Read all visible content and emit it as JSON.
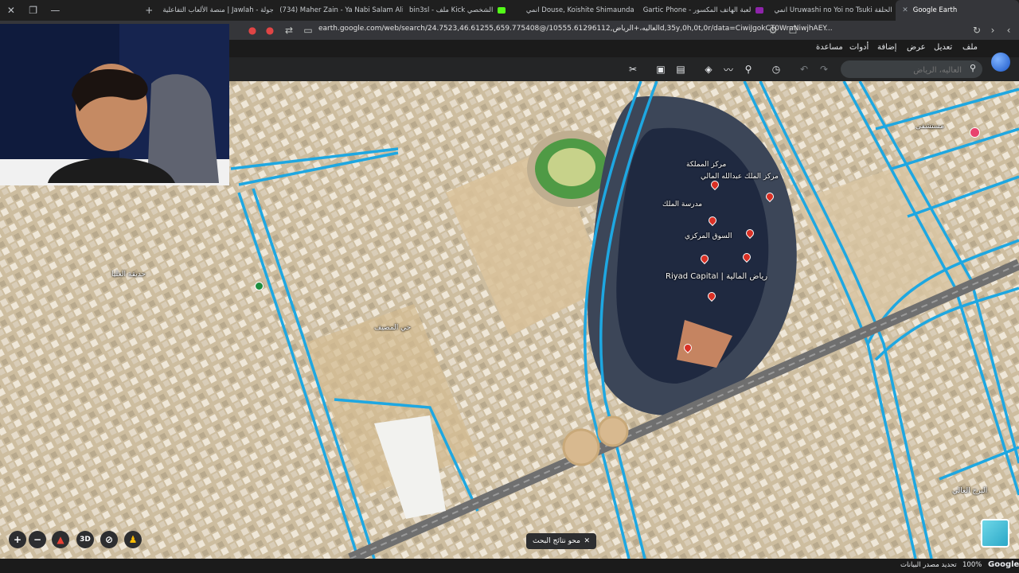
{
  "tabs": [
    {
      "label": "منصة الألعاب التفاعلية | Jawlah - جولة",
      "fav_color": "#f9ab00",
      "active": false
    },
    {
      "label": "(734) Maher Zain - Ya Nabi Salam Ali",
      "fav_color": "#ff0000",
      "active": false
    },
    {
      "label": "bin3sl - ملف Kick الشخصي",
      "fav_color": "#53fc18",
      "active": false
    },
    {
      "label": "انمي Douse, Koishite Shimaunda",
      "fav_color": "#c2185b",
      "active": false
    },
    {
      "label": "Gartic Phone - لعبة الهاتف المكسور",
      "fav_color": "#8e24aa",
      "active": false
    },
    {
      "label": "انمي Uruwashi no Yoi no Tsuki الحلقة",
      "fav_color": "#c2185b",
      "active": false
    },
    {
      "label": "Google Earth",
      "fav_color": "#4285f4",
      "active": true
    }
  ],
  "address": {
    "url": "earth.google.com/web/search/24.7523,46.61255,659.775408@/العاليه،+الرياض,10555.61296112d,35y,0h,0t,0r/data=CiwiJgokCT0WraNiwjhAEY..."
  },
  "menu": [
    "ملف",
    "تعديل",
    "عرض",
    "إضافة",
    "أدوات",
    "مساعدة"
  ],
  "search": {
    "placeholder": "العاليه، الرياض",
    "icon": "search-icon"
  },
  "map_labels": {
    "riyad_capital": "Riyad Capital | رياض المالية",
    "kingdom_center": "مركز المملكة",
    "kafd": "مركز الملك عبدالله المالي",
    "mall": "السوق المركزي",
    "north_label": "مدرسة الملك",
    "district": "حي المصيف",
    "hospital": "مستشفى",
    "tower": "البرج العالي",
    "park": "حديقة العليا"
  },
  "toast": {
    "label": "محو نتائج البحث",
    "close": "✕"
  },
  "controls": {
    "zoom_in": "+",
    "zoom_out": "−",
    "three_d": "3D"
  },
  "status": {
    "brand": "Google",
    "zoom": "100%",
    "data_source": "تحديد مصدر البيانات"
  }
}
